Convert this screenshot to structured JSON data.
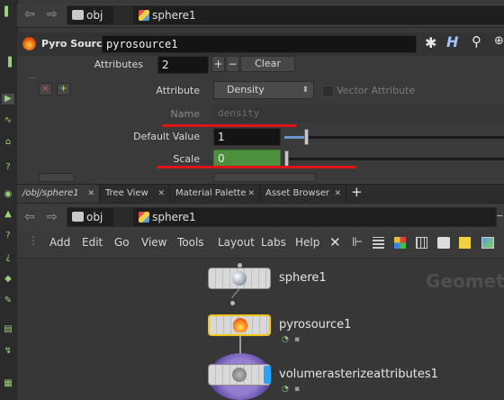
{
  "top_path": {
    "obj": "obj",
    "node": "sphere1"
  },
  "param_header": {
    "node_type": "Pyro Source",
    "node_name": "pyrosource1"
  },
  "attributes": {
    "label": "Attributes",
    "count": "2",
    "plus": "+",
    "minus": "−",
    "clear": "Clear"
  },
  "multiparm": {
    "remove": "×",
    "insert": "+"
  },
  "attribute_row": {
    "label": "Attribute",
    "value": "Density",
    "vector_label": "Vector Attribute"
  },
  "name_row": {
    "label": "Name",
    "placeholder": "density"
  },
  "default_row": {
    "label": "Default Value",
    "value": "1",
    "slider_fraction": 0.1
  },
  "scale_row": {
    "label": "Scale",
    "value": "0"
  },
  "pane_tabs": [
    {
      "label": "/obj/sphere1"
    },
    {
      "label": "Tree View"
    },
    {
      "label": "Material Palette"
    },
    {
      "label": "Asset Browser"
    }
  ],
  "new_tab": "+",
  "net_path": {
    "obj": "obj",
    "node": "sphere1"
  },
  "menu": [
    "Add",
    "Edit",
    "Go",
    "View",
    "Tools",
    "Layout",
    "Labs",
    "Help"
  ],
  "network_watermark": "Geomet",
  "nodes": [
    {
      "name": "sphere1"
    },
    {
      "name": "pyrosource1"
    },
    {
      "name": "volumerasterizeattributes1"
    }
  ],
  "colors": {
    "accent_yellow": "#f0c419",
    "annotation_red": "#e01418",
    "scale_green": "#4c8f3c",
    "vol_purple": "#7b5fc8"
  }
}
